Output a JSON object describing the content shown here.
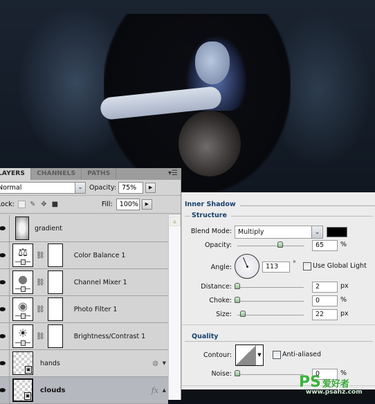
{
  "layers_panel": {
    "tabs": [
      {
        "label": "LAYERS",
        "active": true
      },
      {
        "label": "CHANNELS",
        "active": false
      },
      {
        "label": "PATHS",
        "active": false
      }
    ],
    "menu_icon": "panel-menu-icon",
    "blend_mode": "Normal",
    "opacity_label": "Opacity:",
    "opacity_value": "75%",
    "lock_label": "Lock:",
    "fill_label": "Fill:",
    "fill_value": "100%",
    "layers": [
      {
        "name": "gradient",
        "type": "pixel",
        "visible": true,
        "selected": false
      },
      {
        "name": "Color Balance 1",
        "type": "adjustment",
        "icon": "color-balance-icon",
        "visible": true,
        "selected": false
      },
      {
        "name": "Channel Mixer 1",
        "type": "adjustment",
        "icon": "channel-mixer-icon",
        "visible": true,
        "selected": false
      },
      {
        "name": "Photo Filter 1",
        "type": "adjustment",
        "icon": "photo-filter-icon",
        "visible": true,
        "selected": false
      },
      {
        "name": "Brightness/Contrast 1",
        "type": "adjustment",
        "icon": "brightness-contrast-icon",
        "visible": true,
        "selected": false
      },
      {
        "name": "hands",
        "type": "smart-object",
        "visible": true,
        "selected": false
      },
      {
        "name": "clouds",
        "type": "smart-object",
        "visible": true,
        "selected": true,
        "fx": "fx"
      }
    ]
  },
  "layer_style": {
    "section_title": "Inner Shadow",
    "structure_title": "Structure",
    "blend_mode_label": "Blend Mode:",
    "blend_mode_value": "Multiply",
    "shadow_color": "#000000",
    "opacity_label": "Opacity:",
    "opacity_value": "65",
    "opacity_unit": "%",
    "angle_label": "Angle:",
    "angle_value": "113",
    "angle_unit": "°",
    "use_global_light_label": "Use Global Light",
    "use_global_light_checked": false,
    "distance_label": "Distance:",
    "distance_value": "2",
    "distance_unit": "px",
    "choke_label": "Choke:",
    "choke_value": "0",
    "choke_unit": "%",
    "size_label": "Size:",
    "size_value": "22",
    "size_unit": "px",
    "quality_title": "Quality",
    "contour_label": "Contour:",
    "anti_aliased_label": "Anti-aliased",
    "anti_aliased_checked": false,
    "noise_label": "Noise:",
    "noise_value": "0",
    "noise_unit": "%"
  },
  "watermark": {
    "brand": "PS",
    "brand_cn": "爱好者",
    "url": "www.psahz.com"
  }
}
